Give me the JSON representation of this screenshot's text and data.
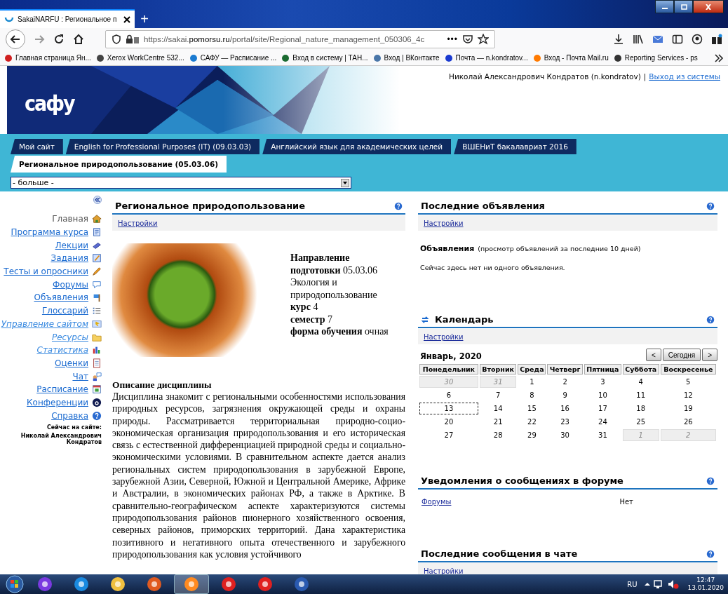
{
  "browser": {
    "tab_title": "SakaiNARFU : Региональное п",
    "new_tab": "+",
    "url_prefix": "https://sakai.",
    "url_domain": "pomorsu.ru",
    "url_path": "/portal/site/Regional_nature_management_050306_4c",
    "url_more": "•••",
    "bookmarks": [
      "Главная страница Ян...",
      "Xerox WorkCentre 532...",
      "САФУ — Расписание ...",
      "Вход в систему | ТАН...",
      "Вход | ВКонтакте",
      "Почта — n.kondratov...",
      "Вход - Почта Mail.ru",
      "Reporting Services - ps"
    ]
  },
  "header": {
    "logo": "сафу",
    "user": "Николай Александрович Кондратов (n.kondratov)",
    "separator": "|",
    "logout": "Выход из системы"
  },
  "site_tabs": [
    {
      "label": "Мой сайт",
      "selected": false
    },
    {
      "label": "English for Professional Purposes (IT) (09.03.03)",
      "selected": false
    },
    {
      "label": "Английский язык для академических целей",
      "selected": false
    },
    {
      "label": "ВШЕНиТ бакалавриат 2016",
      "selected": false
    },
    {
      "label": "Региональное природопользование (05.03.06)",
      "selected": true
    }
  ],
  "more_select": {
    "value": "- больше -"
  },
  "sidebar": {
    "items": [
      {
        "label": "Главная",
        "kind": "current"
      },
      {
        "label": "Программа курса",
        "kind": "link"
      },
      {
        "label": "Лекции",
        "kind": "link"
      },
      {
        "label": "Задания",
        "kind": "link"
      },
      {
        "label": "Тесты и опросники",
        "kind": "link"
      },
      {
        "label": "Форумы",
        "kind": "link"
      },
      {
        "label": "Объявления",
        "kind": "link"
      },
      {
        "label": "Глоссарий",
        "kind": "link"
      },
      {
        "label": "Управление сайтом",
        "kind": "italic"
      },
      {
        "label": "Ресурсы",
        "kind": "italic"
      },
      {
        "label": "Статистика",
        "kind": "italic"
      },
      {
        "label": "Оценки",
        "kind": "link"
      },
      {
        "label": "Чат",
        "kind": "link"
      },
      {
        "label": "Расписание",
        "kind": "link"
      },
      {
        "label": "Конференции",
        "kind": "link"
      },
      {
        "label": "Справка",
        "kind": "link"
      }
    ],
    "online_label": "Сейчас на сайте:",
    "online_user": "Николай Александрович Кондратов"
  },
  "main": {
    "title": "Региональное природопользование",
    "settings": "Настройки",
    "info": [
      "**Направление подготовки** 05.03.06 Экология и природопользование",
      "**курс** 4",
      "**семестр** 7",
      "**форма обучения** очная"
    ],
    "description_title": "Описание дисциплины",
    "description": "Дисциплина знакомит с региональными особенностями использования природных ресурсов, загрязнения окружающей среды и охраны природы. Рассматривается территориальная природно-социо-экономическая организация природопользования и его историческая связь с естественной дифференциацией природной среды и социально-экономическими условиями. В сравнительном аспекте дается анализ региональных систем природопользования в зарубежной Европе, зарубежной Азии, Северной, Южной и Центральной Америке, Африке и Австралии, в экономических районах РФ, а также в Арктике. В сравнительно-географическом аспекте характеризуются системы природопользования районов пионерного хозяйственного освоения, северных районов, приморских территорий. Дана характеристика позитивного и негативного опыта отечественного и зарубежного природопользования как условия устойчивого"
  },
  "announcements": {
    "title": "Последние объявления",
    "settings": "Настройки",
    "heading": "Объявления",
    "heading_note": "(просмотр объявлений за последние 10 дней)",
    "empty": "Сейчас здесь нет ни одного объявления."
  },
  "calendar": {
    "title": "Календарь",
    "settings": "Настройки",
    "month": "Январь, 2020",
    "prev": "<",
    "today_button": "Сегодня",
    "next": ">",
    "weekdays": [
      "Понедельник",
      "Вторник",
      "Среда",
      "Четверг",
      "Пятница",
      "Суббота",
      "Воскресенье"
    ],
    "weeks": [
      [
        {
          "day": "30",
          "kind": "other"
        },
        {
          "day": "31",
          "kind": "other"
        },
        {
          "day": "1",
          "kind": "current"
        },
        {
          "day": "2",
          "kind": "current"
        },
        {
          "day": "3",
          "kind": "current"
        },
        {
          "day": "4",
          "kind": "current"
        },
        {
          "day": "5",
          "kind": "current"
        }
      ],
      [
        {
          "day": "6",
          "kind": "current"
        },
        {
          "day": "7",
          "kind": "current"
        },
        {
          "day": "8",
          "kind": "current"
        },
        {
          "day": "9",
          "kind": "current"
        },
        {
          "day": "10",
          "kind": "current"
        },
        {
          "day": "11",
          "kind": "current"
        },
        {
          "day": "12",
          "kind": "current"
        }
      ],
      [
        {
          "day": "13",
          "kind": "today"
        },
        {
          "day": "14",
          "kind": "current"
        },
        {
          "day": "15",
          "kind": "current"
        },
        {
          "day": "16",
          "kind": "current"
        },
        {
          "day": "17",
          "kind": "current"
        },
        {
          "day": "18",
          "kind": "current"
        },
        {
          "day": "19",
          "kind": "current"
        }
      ],
      [
        {
          "day": "20",
          "kind": "current"
        },
        {
          "day": "21",
          "kind": "current"
        },
        {
          "day": "22",
          "kind": "current"
        },
        {
          "day": "23",
          "kind": "current"
        },
        {
          "day": "24",
          "kind": "current"
        },
        {
          "day": "25",
          "kind": "current"
        },
        {
          "day": "26",
          "kind": "current"
        }
      ],
      [
        {
          "day": "27",
          "kind": "current"
        },
        {
          "day": "28",
          "kind": "current"
        },
        {
          "day": "29",
          "kind": "current"
        },
        {
          "day": "30",
          "kind": "current"
        },
        {
          "day": "31",
          "kind": "current"
        },
        {
          "day": "1",
          "kind": "other"
        },
        {
          "day": "2",
          "kind": "other"
        }
      ]
    ]
  },
  "forum_notices": {
    "title": "Уведомления о сообщениях в форуме",
    "link": "Форумы",
    "value": "Нет"
  },
  "chat": {
    "title": "Последние сообщения в чате",
    "settings": "Настройки"
  },
  "taskbar": {
    "language": "RU",
    "time": "12:47",
    "date": "13.01.2020"
  }
}
